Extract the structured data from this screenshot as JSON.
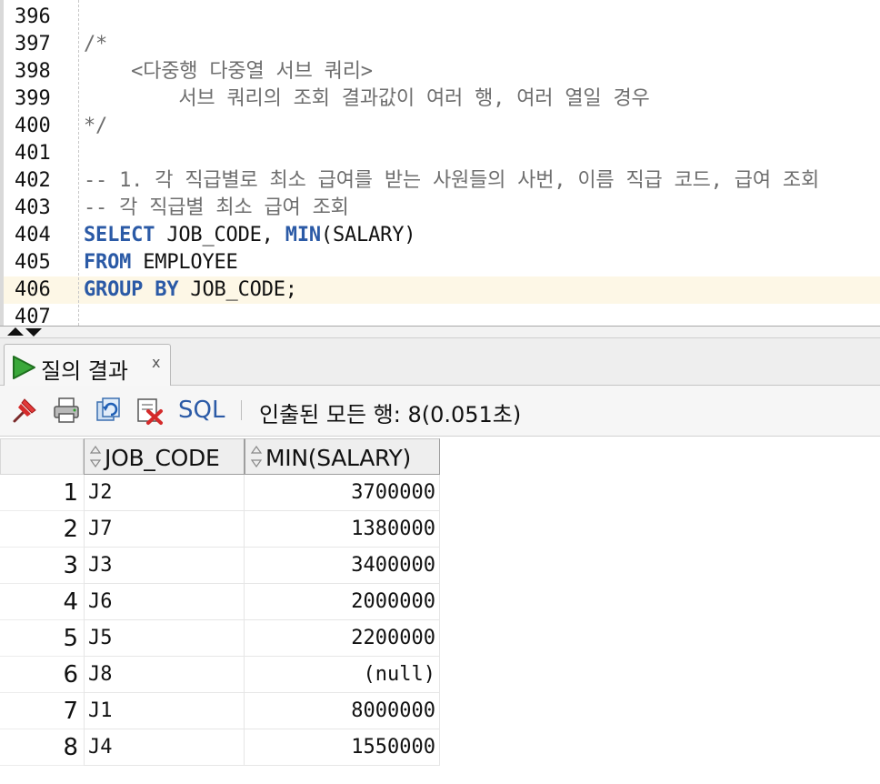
{
  "editor": {
    "lines": [
      {
        "num": "396",
        "parts": [],
        "current": false
      },
      {
        "num": "397",
        "parts": [
          {
            "t": "/*",
            "k": "comment"
          }
        ],
        "current": false
      },
      {
        "num": "398",
        "parts": [
          {
            "t": "    <다중행 다중열 서브 쿼리>",
            "k": "comment"
          }
        ],
        "current": false
      },
      {
        "num": "399",
        "parts": [
          {
            "t": "        서브 쿼리의 조회 결과값이 여러 행, 여러 열일 경우",
            "k": "comment"
          }
        ],
        "current": false
      },
      {
        "num": "400",
        "parts": [
          {
            "t": "*/",
            "k": "comment"
          }
        ],
        "current": false
      },
      {
        "num": "401",
        "parts": [],
        "current": false
      },
      {
        "num": "402",
        "parts": [
          {
            "t": "-- 1. 각 직급별로 최소 급여를 받는 사원들의 사번, 이름 직급 코드, 급여 조회",
            "k": "comment"
          }
        ],
        "current": false
      },
      {
        "num": "403",
        "parts": [
          {
            "t": "-- 각 직급별 최소 급여 조회",
            "k": "comment"
          }
        ],
        "current": false
      },
      {
        "num": "404",
        "parts": [
          {
            "t": "SELECT",
            "k": "kw"
          },
          {
            "t": " JOB_CODE, ",
            "k": "plain"
          },
          {
            "t": "MIN",
            "k": "kw"
          },
          {
            "t": "(SALARY)",
            "k": "plain"
          }
        ],
        "current": false
      },
      {
        "num": "405",
        "parts": [
          {
            "t": "FROM",
            "k": "kw"
          },
          {
            "t": " EMPLOYEE",
            "k": "plain"
          }
        ],
        "current": false
      },
      {
        "num": "406",
        "parts": [
          {
            "t": "GROUP BY",
            "k": "kw"
          },
          {
            "t": " JOB_CODE;",
            "k": "plain"
          }
        ],
        "current": true
      },
      {
        "num": "407",
        "parts": [],
        "current": false
      }
    ]
  },
  "result_tab": {
    "label": "질의 결과",
    "close": "x"
  },
  "toolbar": {
    "sql_label": "SQL",
    "status": "인출된 모든 행: 8(0.051초)"
  },
  "grid": {
    "columns": [
      "JOB_CODE",
      "MIN(SALARY)"
    ],
    "rows": [
      {
        "num": "1",
        "job_code": "J2",
        "min_salary": "3700000"
      },
      {
        "num": "2",
        "job_code": "J7",
        "min_salary": "1380000"
      },
      {
        "num": "3",
        "job_code": "J3",
        "min_salary": "3400000"
      },
      {
        "num": "4",
        "job_code": "J6",
        "min_salary": "2000000"
      },
      {
        "num": "5",
        "job_code": "J5",
        "min_salary": "2200000"
      },
      {
        "num": "6",
        "job_code": "J8",
        "min_salary": "(null)"
      },
      {
        "num": "7",
        "job_code": "J1",
        "min_salary": "8000000"
      },
      {
        "num": "8",
        "job_code": "J4",
        "min_salary": "1550000"
      }
    ]
  },
  "colors": {
    "keyword": "#2b5aa6",
    "comment": "#6e6e6e",
    "current_line": "#fdf7e6",
    "run_icon": "#2f9e2f"
  },
  "icons": [
    "run-icon",
    "pin-icon",
    "print-icon",
    "refresh-icon",
    "delete-icon",
    "sort-icon",
    "splitter-arrow-icon"
  ]
}
